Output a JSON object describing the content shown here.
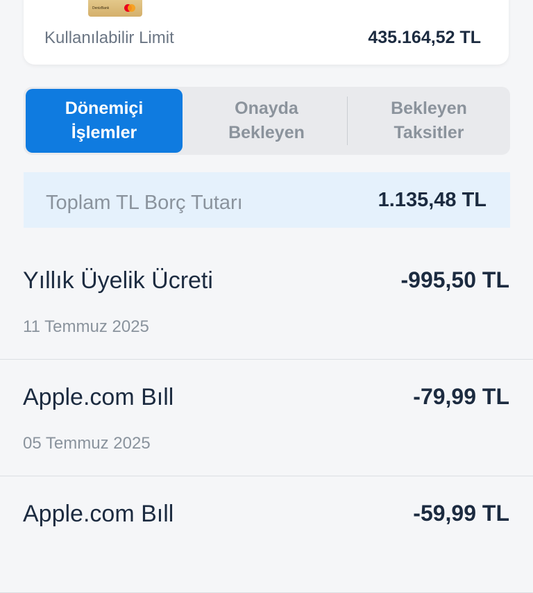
{
  "limit_card": {
    "card_bank_text": "DenizBank",
    "label": "Kullanılabilir Limit",
    "value": "435.164,52 TL"
  },
  "tabs": [
    {
      "label": "Dönemiçi\nİşlemler",
      "active": true
    },
    {
      "label": "Onayda\nBekleyen",
      "active": false
    },
    {
      "label": "Bekleyen\nTaksitler",
      "active": false
    }
  ],
  "debt_summary": {
    "label": "Toplam TL Borç Tutarı",
    "value": "1.135,48 TL"
  },
  "transactions": [
    {
      "title": "Yıllık Üyelik Ücreti",
      "amount": "-995,50 TL",
      "date": "11 Temmuz 2025"
    },
    {
      "title": "Apple.com Bıll",
      "amount": "-79,99 TL",
      "date": "05 Temmuz 2025"
    },
    {
      "title": "Apple.com Bıll",
      "amount": "-59,99 TL",
      "date": ""
    }
  ],
  "colors": {
    "accent": "#0f7be0",
    "text_dark": "#1c2b40",
    "text_muted": "#8a939d",
    "summary_bg": "#e5f1fc"
  }
}
